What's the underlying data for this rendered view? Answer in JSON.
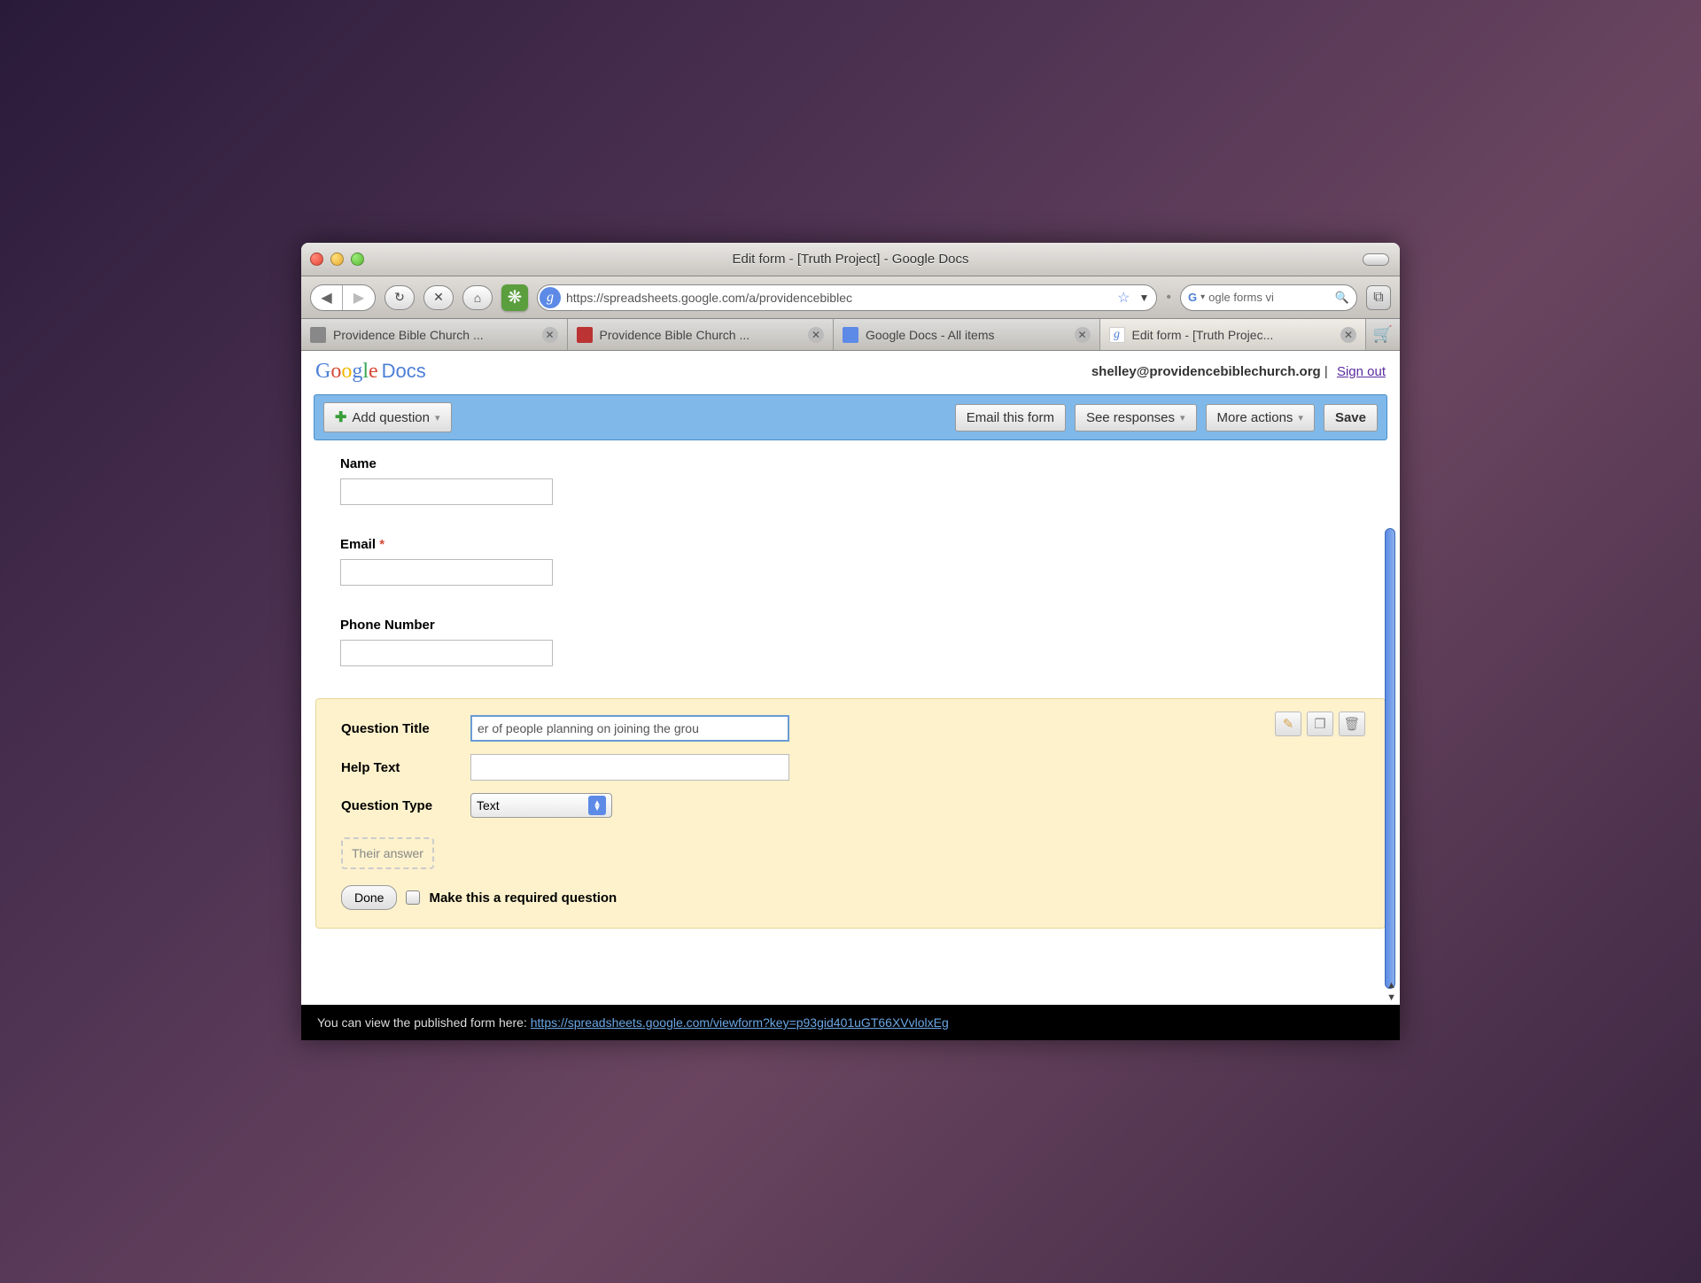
{
  "window": {
    "title": "Edit form - [Truth Project] - Google Docs"
  },
  "url": {
    "text": "https://spreadsheets.google.com/a/providencebiblec"
  },
  "search": {
    "value": "ogle forms vi"
  },
  "tabs": [
    {
      "label": "Providence Bible Church ...",
      "fav": "plain"
    },
    {
      "label": "Providence Bible Church ...",
      "fav": "red"
    },
    {
      "label": "Google Docs - All items",
      "fav": "blue"
    },
    {
      "label": "Edit form - [Truth Projec...",
      "fav": "google",
      "selected": true
    }
  ],
  "account": {
    "email": "shelley@providencebiblechurch.org",
    "signout": "Sign out"
  },
  "logo": {
    "docs": "Docs"
  },
  "toolbar": {
    "add": "Add question",
    "email": "Email this form",
    "responses": "See responses",
    "more": "More actions",
    "save": "Save"
  },
  "questions": [
    {
      "label": "Name",
      "required": false
    },
    {
      "label": "Email",
      "required": true
    },
    {
      "label": "Phone Number",
      "required": false
    }
  ],
  "editor": {
    "title_label": "Question Title",
    "title_value": "er of people planning on joining the grou",
    "help_label": "Help Text",
    "help_value": "",
    "type_label": "Question Type",
    "type_value": "Text",
    "answer_placeholder": "Their answer",
    "done": "Done",
    "required_label": "Make this a required question"
  },
  "footer": {
    "text": "You can view the published form here: ",
    "link": "https://spreadsheets.google.com/viewform?key=p93gid401uGT66XVvlolxEg"
  }
}
